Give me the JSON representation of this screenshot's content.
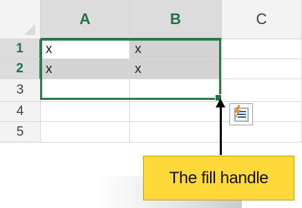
{
  "columns": [
    {
      "label": "A",
      "selected": true
    },
    {
      "label": "B",
      "selected": true
    },
    {
      "label": "C",
      "selected": false
    }
  ],
  "rows": [
    {
      "label": "1",
      "selected": true,
      "cells": [
        "x",
        "x",
        ""
      ]
    },
    {
      "label": "2",
      "selected": true,
      "cells": [
        "x",
        "x",
        ""
      ]
    },
    {
      "label": "3",
      "selected": false,
      "cells": [
        "",
        "",
        ""
      ]
    },
    {
      "label": "4",
      "selected": false,
      "cells": [
        "",
        "",
        ""
      ]
    },
    {
      "label": "5",
      "selected": false,
      "cells": [
        "",
        "",
        ""
      ]
    }
  ],
  "colors": {
    "selection_accent": "#217346",
    "selected_header_bg": "#dcdcdc",
    "filled_cell_bg": "#d3d3d3",
    "callout_bg": "#ffd83a"
  },
  "icons": {
    "flash_fill": "flash-fill-icon",
    "fill_handle": "fill-handle"
  },
  "callout": {
    "text": "The fill handle"
  }
}
